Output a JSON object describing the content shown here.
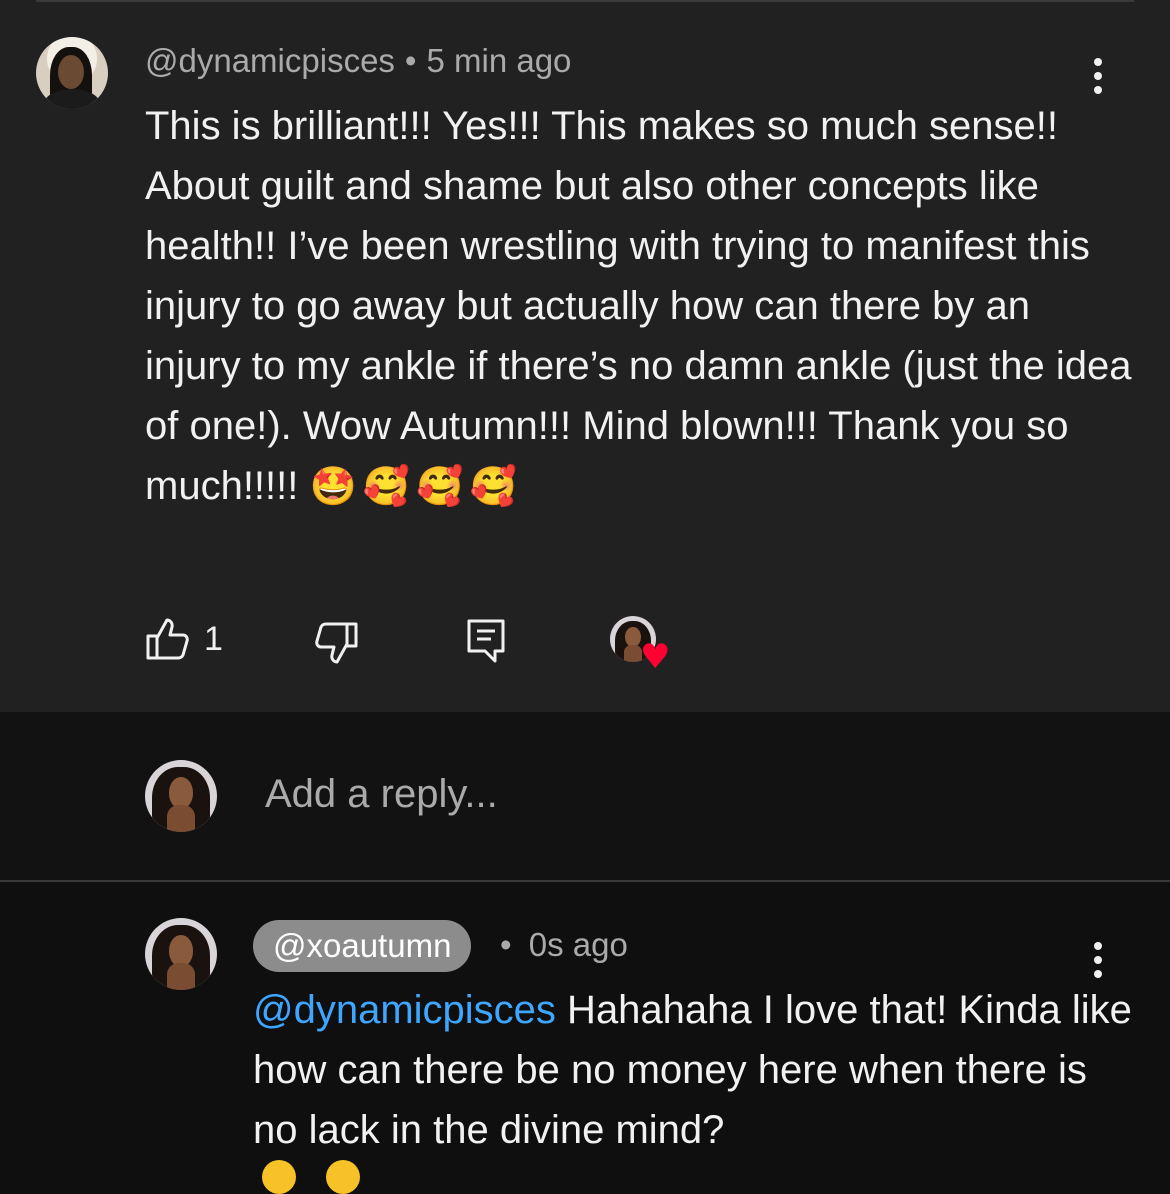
{
  "comment": {
    "author": "@dynamicpisces",
    "time": "5 min ago",
    "separator": "•",
    "text": "This is brilliant!!! Yes!!! This makes so much sense!! About guilt and shame but also other concepts like health!! I’ve been wrestling with trying to manifest this injury to go away but actually how can there by an injury to my ankle if there’s no damn ankle (just the idea of one!). Wow Autumn!!! Mind blown!!! Thank you so much!!!!!",
    "emojis": "🤩🥰🥰🥰",
    "like_count": "1",
    "icons": {
      "like": "thumbs-up-icon",
      "dislike": "thumbs-down-icon",
      "reply": "reply-icon",
      "creator_heart": "heart-icon",
      "more": "more-vertical-icon"
    },
    "heart_color": "#ff0033"
  },
  "reply_box": {
    "placeholder": "Add a reply..."
  },
  "reply": {
    "author": "@xoautumn",
    "time": "0s ago",
    "separator": "•",
    "mention": "@dynamicpisces",
    "text": " Hahahaha I love that! Kinda like how can there be no money here when there is no lack in the divine mind?",
    "mention_color": "#3ea6ff"
  }
}
